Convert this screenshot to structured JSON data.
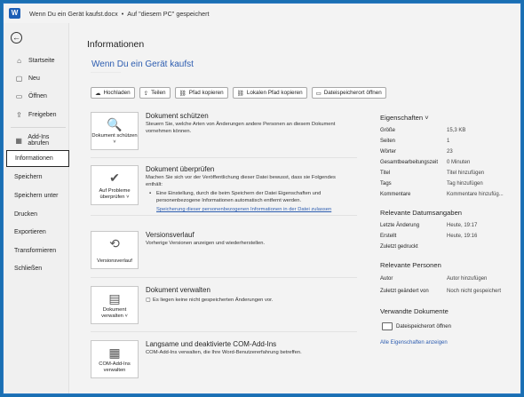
{
  "titlebar": {
    "app_icon": "word-icon",
    "app_letter": "W",
    "filename": "Wenn Du ein Gerät kaufst.docx",
    "separator": "•",
    "save_status": "Auf \"diesem PC\" gespeichert"
  },
  "sidebar": {
    "back_icon": "back-arrow-icon",
    "items": [
      {
        "label": "Startseite",
        "icon": "home-icon",
        "glyph": "⌂"
      },
      {
        "label": "Neu",
        "icon": "new-document-icon",
        "glyph": "▢"
      },
      {
        "label": "Öffnen",
        "icon": "folder-open-icon",
        "glyph": "▭"
      },
      {
        "label": "Freigeben",
        "icon": "share-icon",
        "glyph": "⇪"
      },
      {
        "label": "Add-Ins abrufen",
        "icon": "addins-icon",
        "glyph": "▦"
      },
      {
        "label": "Informationen",
        "icon": "",
        "glyph": ""
      },
      {
        "label": "Speichern",
        "icon": "",
        "glyph": ""
      },
      {
        "label": "Speichern unter",
        "icon": "",
        "glyph": ""
      },
      {
        "label": "Drucken",
        "icon": "",
        "glyph": ""
      },
      {
        "label": "Exportieren",
        "icon": "",
        "glyph": ""
      },
      {
        "label": "Transformieren",
        "icon": "",
        "glyph": ""
      },
      {
        "label": "Schließen",
        "icon": "",
        "glyph": ""
      }
    ],
    "active": "Informationen"
  },
  "main": {
    "title": "Informationen",
    "doc_title": "Wenn Du ein Gerät kaufst",
    "actions": [
      {
        "label": "Hochladen",
        "icon": "cloud-upload-icon",
        "glyph": "☁"
      },
      {
        "label": "Teilen",
        "icon": "share-icon",
        "glyph": "⇪"
      },
      {
        "label": "Pfad kopieren",
        "icon": "link-icon",
        "glyph": "⛓"
      },
      {
        "label": "Lokalen Pfad kopieren",
        "icon": "link-icon",
        "glyph": "⛓"
      },
      {
        "label": "Dateispeicherort öffnen",
        "icon": "folder-icon",
        "glyph": "▭"
      }
    ],
    "sections": {
      "protect": {
        "box_label": "Dokument schützen ˅",
        "icon": "lock-document-icon",
        "glyph": "🔍",
        "title": "Dokument schützen",
        "desc": "Steuern Sie, welche Arten von Änderungen andere Personen an diesem Dokument vornehmen können."
      },
      "inspect": {
        "box_label": "Auf Probleme überprüfen ˅",
        "icon": "check-document-icon",
        "glyph": "✔",
        "title": "Dokument überprüfen",
        "desc": "Machen Sie sich vor der Veröffentlichung dieser Datei bewusst, dass sie Folgendes enthält:",
        "bullet": "Eine Einstellung, durch die beim Speichern der Datei Eigenschaften und personenbezogene Informationen automatisch entfernt werden.",
        "link": "Speicherung dieser personenbezogenen Informationen in der Datei zulassen"
      },
      "versions": {
        "box_label": "Versionsverlauf",
        "icon": "history-icon",
        "glyph": "⟲",
        "title": "Versionsverlauf",
        "desc": "Vorherige Versionen anzeigen und wiederherstellen."
      },
      "manage": {
        "box_label": "Dokument verwalten ˅",
        "icon": "manage-document-icon",
        "glyph": "▤",
        "title": "Dokument verwalten",
        "bullet_icon": "document-icon",
        "bullet": "Es liegen keine nicht gespeicherten Änderungen vor."
      },
      "com": {
        "box_label": "COM-Add-Ins verwalten",
        "icon": "com-addins-icon",
        "glyph": "▦",
        "title": "Langsame und deaktivierte COM-Add-Ins",
        "desc": "COM-Add-Ins verwalten, die Ihre Word-Benutzererfahrung betreffen."
      }
    }
  },
  "properties": {
    "header": "Eigenschaften ˅",
    "rows": [
      {
        "k": "Größe",
        "v": "15,3 KB"
      },
      {
        "k": "Seiten",
        "v": "1"
      },
      {
        "k": "Wörter",
        "v": "23"
      },
      {
        "k": "Gesamtbearbeitungszeit",
        "v": "0 Minuten"
      },
      {
        "k": "Titel",
        "v": "Titel hinzufügen"
      },
      {
        "k": "Tags",
        "v": "Tag hinzufügen"
      },
      {
        "k": "Kommentare",
        "v": "Kommentare hinzufüg..."
      }
    ],
    "dates_header": "Relevante Datumsangaben",
    "dates": [
      {
        "k": "Letzte Änderung",
        "v": "Heute, 19:17"
      },
      {
        "k": "Erstellt",
        "v": "Heute, 19:16"
      },
      {
        "k": "Zuletzt gedruckt",
        "v": ""
      }
    ],
    "people_header": "Relevante Personen",
    "people": [
      {
        "k": "Autor",
        "v": "Autor hinzufügen"
      },
      {
        "k": "Zuletzt geändert von",
        "v": "Noch nicht gespeichert"
      }
    ],
    "related_header": "Verwandte Dokumente",
    "related_doc": "Dateispeicherort öffnen",
    "all_props_link": "Alle Eigenschaften anzeigen"
  }
}
